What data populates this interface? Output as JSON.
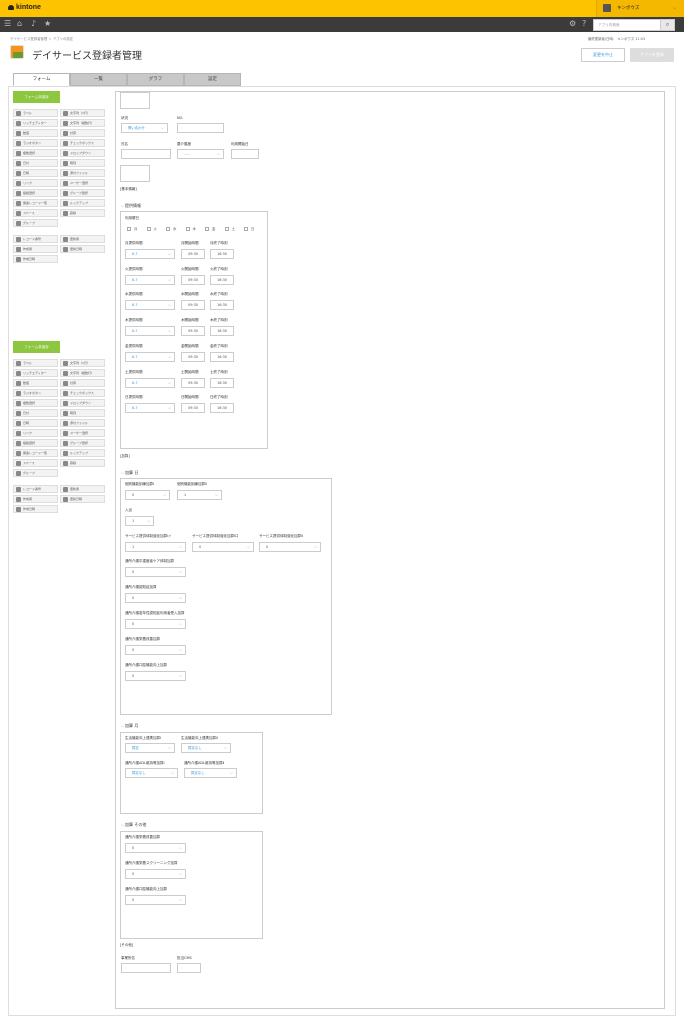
{
  "header": {
    "logo": "kintone",
    "user_name": "キンボウズ",
    "app_search_placeholder": "アプリ内検索",
    "breadcrumb": "デイサービス登録者管理 ＞ アプリの設定",
    "right_info": "最終更新者/日時：  キンボウズ  11:03",
    "title": "デイサービス登録者管理",
    "btn_stop": "変更を中止",
    "btn_update": "アプリを更新"
  },
  "tabs": [
    "フォーム",
    "一覧",
    "グラフ",
    "設定"
  ],
  "palette": {
    "button": "フォーム未保存",
    "items": [
      "ラベル",
      "文字列（1行）",
      "リッチエディター",
      "文字列（複数行）",
      "数値",
      "計算",
      "ラジオボタン",
      "チェックボックス",
      "複数選択",
      "ドロップダウン",
      "日付",
      "時刻",
      "日時",
      "添付ファイル",
      "リンク",
      "ユーザー選択",
      "組織選択",
      "グループ選択",
      "関連レコード一覧",
      "ルックアップ",
      "スペース",
      "罫線",
      "グループ"
    ],
    "system": [
      "レコード番号",
      "作成者",
      "作成日時",
      "更新者",
      "更新日時"
    ]
  },
  "form": {
    "status_label": "状況",
    "status_value": "問い合わせ",
    "no_label": "NO.",
    "name_label": "氏名",
    "care_label": "要介護度",
    "care_value": "-----",
    "start_label": "利用開始日",
    "basic_info": "[基本情報]",
    "g1_title": "提供情報",
    "g1_use_days": "利用曜日",
    "days": [
      "月",
      "火",
      "水",
      "木",
      "金",
      "土",
      "日"
    ],
    "dow": [
      {
        "a": "月提供時間",
        "b": "月開始時間",
        "c": "月終了時刻"
      },
      {
        "a": "火提供時間",
        "b": "火開始時間",
        "c": "火終了時刻"
      },
      {
        "a": "水提供時間",
        "b": "水開始時間",
        "c": "水終了時刻"
      },
      {
        "a": "木提供時間",
        "b": "木開始時間",
        "c": "木終了時刻"
      },
      {
        "a": "金提供時間",
        "b": "金開始時間",
        "c": "金終了時刻"
      },
      {
        "a": "土提供時間",
        "b": "土開始時間",
        "c": "土終了時刻"
      },
      {
        "a": "日提供時間",
        "b": "日開始時間",
        "c": "日終了時刻"
      }
    ],
    "sel_time": "6-7",
    "time_start": "09:30",
    "time_end": "16:30",
    "kasan_label": "[加算]",
    "g2_title": "加算 日",
    "g2_r1a": "個別機能訓練加算Ⅰ",
    "g2_r1b": "個別機能訓練加算Ⅱ",
    "g2_bath": "入浴",
    "g2_r3a": "サービス提供体制強化加算Ⅰイ",
    "g2_r3b": "サービス提供体制強化加算Ⅰロ",
    "g2_r3c": "サービス提供体制強化加算Ⅱ",
    "g2_l4": "通所介護若年性認知症利用者受入加算",
    "g2_l5": "通所介護認知症加算",
    "g2_l6": "通所介護栄養改善加算",
    "g2_l7": "通所介護口腔機能向上加算",
    "g2_l8": "通所介護中重度者ケア体制加算",
    "v0": "0",
    "v1": "1",
    "g3_title": "加算 月",
    "g3_r1a": "生活機能向上連携加算Ⅰ",
    "g3_r1b": "生活機能向上連携加算Ⅱ",
    "g3_r2a": "通所介護ADL維持等加算Ⅰ",
    "g3_r2b": "通所介護ADL維持等加算Ⅱ",
    "sel_calc": "算定",
    "sel_none": "算定なし",
    "g4_title": "加算 その他",
    "g4_l1": "通所介護栄養改善加算",
    "g4_l2": "通所介護栄養スクリーニング加算",
    "g4_l3": "通所介護口腔機能向上加算",
    "other_label": "[その他]",
    "office_label": "事業所名",
    "sign_label": "担当CMS"
  }
}
